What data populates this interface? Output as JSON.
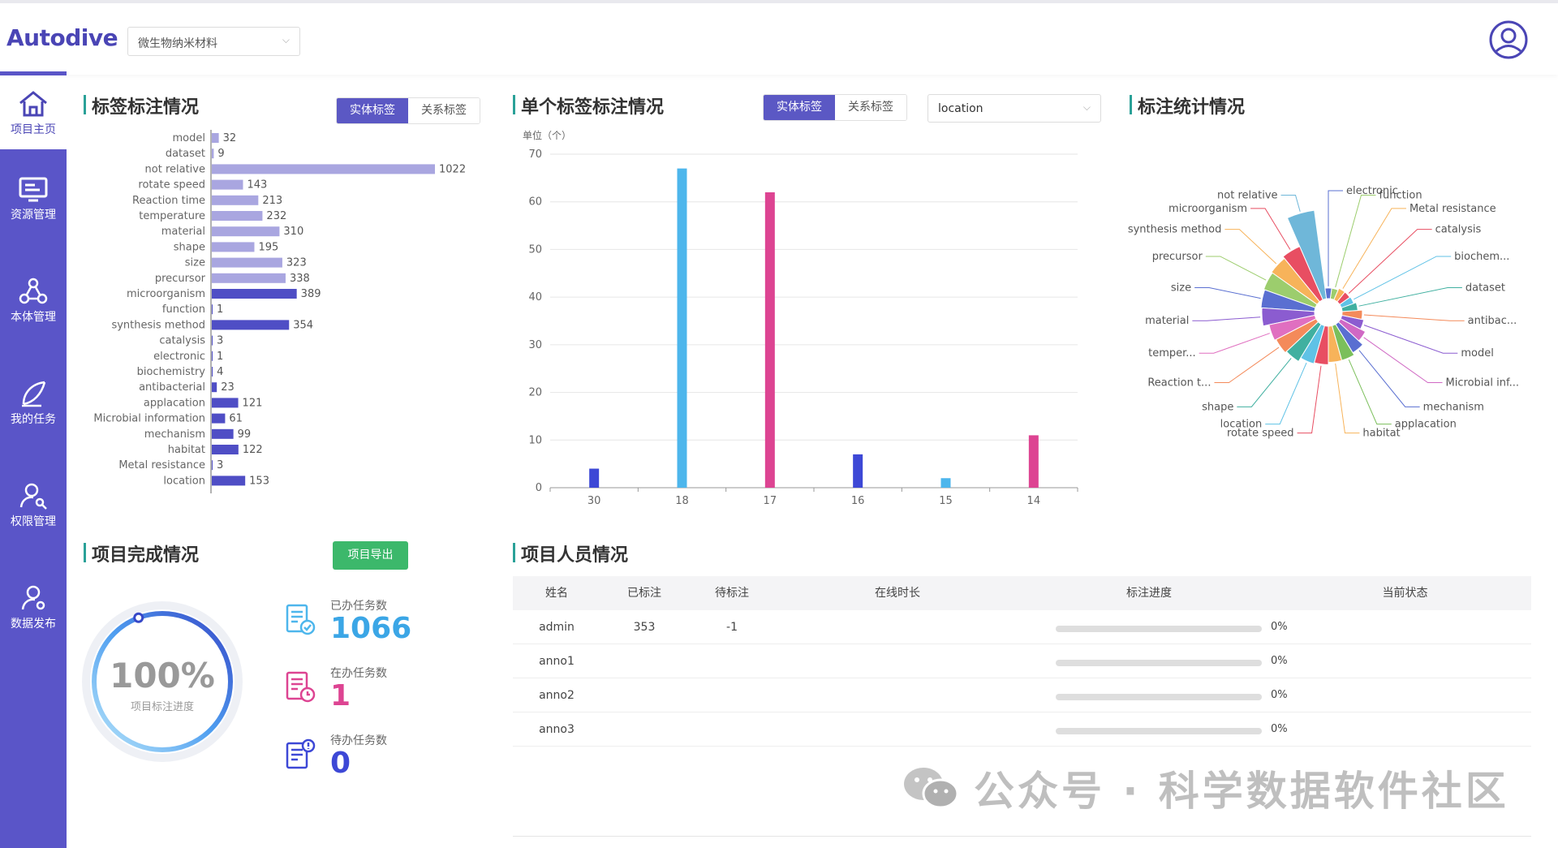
{
  "app": {
    "logo": "Autodive",
    "project": "微生物纳米材料",
    "user_icon": "user-circle-icon"
  },
  "sidebar": {
    "items": [
      {
        "label": "项目主页",
        "icon": "home-icon",
        "active": true
      },
      {
        "label": "资源管理",
        "icon": "monitor-icon"
      },
      {
        "label": "本体管理",
        "icon": "graph-icon"
      },
      {
        "label": "我的任务",
        "icon": "feather-icon"
      },
      {
        "label": "权限管理",
        "icon": "user-key-icon"
      },
      {
        "label": "数据发布",
        "icon": "user-share-icon"
      }
    ]
  },
  "tag_panel": {
    "title": "标签标注情况",
    "tab_entity": "实体标签",
    "tab_relation": "关系标签"
  },
  "single_panel": {
    "title": "单个标签标注情况",
    "tab_entity": "实体标签",
    "tab_relation": "关系标签",
    "select_value": "location"
  },
  "stats_panel": {
    "title": "标注统计情况"
  },
  "complete_panel": {
    "title": "项目完成情况",
    "export_label": "项目导出",
    "percent": "100%",
    "percent_label": "项目标注进度",
    "progress": 1.0,
    "done_label": "已办任务数",
    "done_value": "1066",
    "doing_label": "在办任务数",
    "doing_value": "1",
    "todo_label": "待办任务数",
    "todo_value": "0"
  },
  "people_panel": {
    "title": "项目人员情况",
    "headers": [
      "姓名",
      "已标注",
      "待标注",
      "在线时长",
      "标注进度",
      "当前状态"
    ],
    "rows": [
      {
        "name": "admin",
        "done": "353",
        "pending": "-1",
        "online": "",
        "progress": "0%",
        "status": ""
      },
      {
        "name": "anno1",
        "done": "",
        "pending": "",
        "online": "",
        "progress": "0%",
        "status": ""
      },
      {
        "name": "anno2",
        "done": "",
        "pending": "",
        "online": "",
        "progress": "0%",
        "status": ""
      },
      {
        "name": "anno3",
        "done": "",
        "pending": "",
        "online": "",
        "progress": "0%",
        "status": ""
      }
    ]
  },
  "watermark": "公众号 · 科学数据软件社区",
  "chart_data": [
    {
      "type": "bar",
      "orientation": "horizontal",
      "categories": [
        "model",
        "dataset",
        "not relative",
        "rotate speed",
        "Reaction time",
        "temperature",
        "material",
        "shape",
        "size",
        "precursor",
        "microorganism",
        "function",
        "synthesis method",
        "catalysis",
        "electronic",
        "biochemistry",
        "antibacterial",
        "applacation",
        "Microbial information",
        "mechanism",
        "habitat",
        "Metal resistance",
        "location"
      ],
      "values": [
        32,
        9,
        1022,
        143,
        213,
        232,
        310,
        195,
        323,
        338,
        389,
        1,
        354,
        3,
        1,
        4,
        23,
        121,
        61,
        99,
        122,
        3,
        153
      ],
      "colors": {
        "light": "#a9a6e0",
        "dark": "#4f4ec5"
      }
    },
    {
      "type": "bar",
      "unit_label": "单位（个）",
      "categories": [
        "30",
        "18",
        "17",
        "16",
        "15",
        "14"
      ],
      "values": [
        4,
        67,
        62,
        7,
        2,
        11
      ],
      "colors": [
        "#3d48d6",
        "#4db6ec",
        "#dd4492",
        "#3d48d6",
        "#4db6ec",
        "#dd4492"
      ],
      "yticks": [
        0,
        10,
        20,
        30,
        40,
        50,
        60,
        70
      ],
      "ylim": [
        0,
        70
      ]
    },
    {
      "type": "pie",
      "variant": "rose",
      "slices": [
        {
          "label": "not relative",
          "value": 1022,
          "color": "#6fb7d9"
        },
        {
          "label": "microorganism",
          "value": 389,
          "color": "#e84e62"
        },
        {
          "label": "synthesis method",
          "value": 354,
          "color": "#f7b35a"
        },
        {
          "label": "precursor",
          "value": 338,
          "color": "#9ccd6d"
        },
        {
          "label": "size",
          "value": 323,
          "color": "#5a6fd1"
        },
        {
          "label": "material",
          "value": 310,
          "color": "#8b5cd0"
        },
        {
          "label": "temper...",
          "value": 232,
          "color": "#e06fc0"
        },
        {
          "label": "Reaction t...",
          "value": 213,
          "color": "#f48a5a"
        },
        {
          "label": "shape",
          "value": 195,
          "color": "#40b0a0"
        },
        {
          "label": "location",
          "value": 153,
          "color": "#5fc2e6"
        },
        {
          "label": "rotate speed",
          "value": 143,
          "color": "#e84e62"
        },
        {
          "label": "habitat",
          "value": 122,
          "color": "#f7b35a"
        },
        {
          "label": "applacation",
          "value": 121,
          "color": "#7bbf5b"
        },
        {
          "label": "mechanism",
          "value": 99,
          "color": "#5a6fd1"
        },
        {
          "label": "Microbial inf...",
          "value": 61,
          "color": "#d068c4"
        },
        {
          "label": "model",
          "value": 32,
          "color": "#8b5cd0"
        },
        {
          "label": "antibac...",
          "value": 23,
          "color": "#f48a5a"
        },
        {
          "label": "dataset",
          "value": 9,
          "color": "#40b0a0"
        },
        {
          "label": "biochem...",
          "value": 4,
          "color": "#5fc2e6"
        },
        {
          "label": "catalysis",
          "value": 3,
          "color": "#e84e62"
        },
        {
          "label": "Metal resistance",
          "value": 3,
          "color": "#f7b35a"
        },
        {
          "label": "function",
          "value": 1,
          "color": "#9ccd6d"
        },
        {
          "label": "electronic",
          "value": 1,
          "color": "#5a6fd1"
        }
      ]
    }
  ]
}
